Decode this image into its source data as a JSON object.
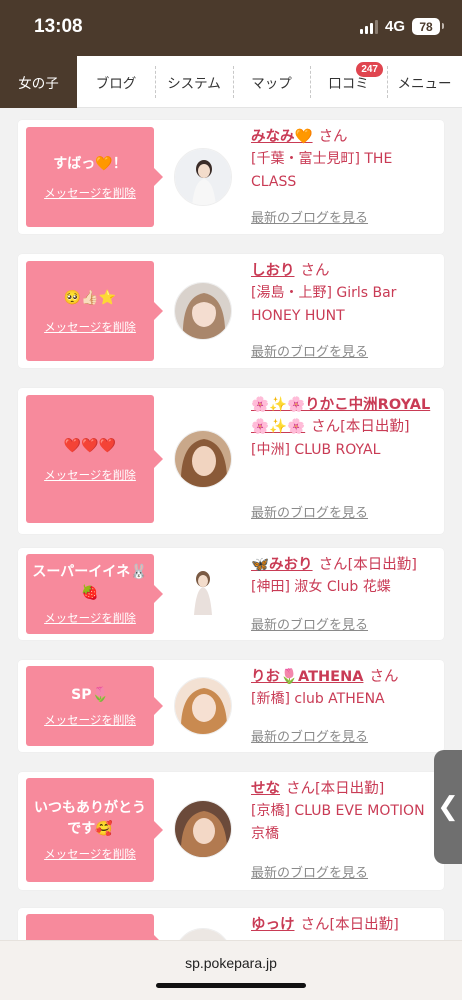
{
  "status": {
    "time": "13:08",
    "network": "4G",
    "battery": "78"
  },
  "tabs": [
    {
      "label": "女の子",
      "active": true
    },
    {
      "label": "ブログ"
    },
    {
      "label": "システム"
    },
    {
      "label": "マップ"
    },
    {
      "label": "口コミ",
      "badge": "247"
    },
    {
      "label": "メニュー"
    }
  ],
  "delete_label": "メッセージを削除",
  "blog_label": "最新のブログを見る",
  "san": "さん",
  "cards": [
    {
      "message": "すばっ🧡！",
      "name": "みなみ🧡",
      "status": "",
      "shop": "[千葉・富士見町] THE CLASS"
    },
    {
      "message": "🥺👍🏻⭐",
      "name": "しおり",
      "status": "",
      "shop": "[湯島・上野] Girls Bar HONEY HUNT"
    },
    {
      "message": "❤️❤️❤️",
      "name": "🌸✨🌸りかこ中洲ROYAL🌸✨🌸",
      "status": "[本日出勤]",
      "shop": "[中洲] CLUB ROYAL"
    },
    {
      "message": "スーパーイイネ🐰🍓",
      "name": "🦋みおり",
      "status": "[本日出勤]",
      "shop": "[神田] 淑女 Club 花蝶"
    },
    {
      "message": "SP🌷",
      "name": "りお🌷ATHENA",
      "status": "",
      "shop": "[新橋] club ATHENA"
    },
    {
      "message": "いつもありがとうです🥰",
      "name": "せな",
      "status": "[本日出勤]",
      "shop": "[京橋] CLUB EVE MOTION 京橋"
    },
    {
      "message": "",
      "name": "ゆっけ",
      "status": "[本日出勤]",
      "shop": ""
    }
  ],
  "url": "sp.pokepara.jp",
  "colors": {
    "brand_brown": "#4b3a2c",
    "bubble_pink": "#f78a9c",
    "name_red": "#c93b55"
  }
}
